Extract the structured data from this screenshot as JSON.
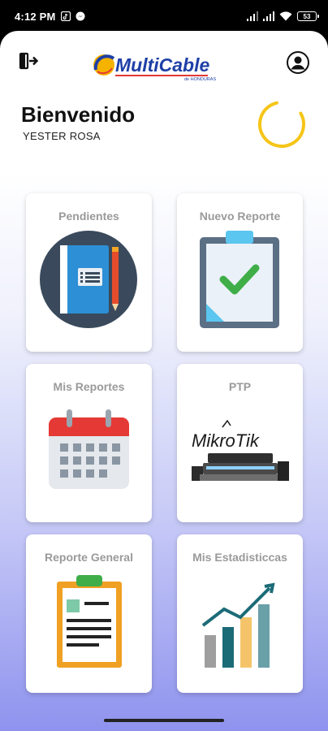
{
  "status_bar": {
    "time": "4:12 PM",
    "battery": "53",
    "icons": [
      "tiktok-icon",
      "messenger-icon",
      "signal-icon",
      "signal-icon",
      "wifi-icon",
      "battery-icon"
    ]
  },
  "header": {
    "logo_text": "MultiCable",
    "logo_subtext": "de HONDURAS",
    "logout_icon": "logout-icon",
    "profile_icon": "profile-icon"
  },
  "welcome": {
    "title": "Bienvenido",
    "user": "YESTER ROSA"
  },
  "cards": [
    {
      "title": "Pendientes",
      "icon": "notebook-icon"
    },
    {
      "title": "Nuevo Reporte",
      "icon": "clipboard-check-icon"
    },
    {
      "title": "Mis Reportes",
      "icon": "calendar-icon"
    },
    {
      "title": "PTP",
      "icon": "mikrotik-router-icon",
      "brand_text": "MikroTik"
    },
    {
      "title": "Reporte General",
      "icon": "clipboard-document-icon"
    },
    {
      "title": "Mis Estadisticcas",
      "icon": "bar-chart-icon"
    }
  ],
  "colors": {
    "spinner": "#f5c518",
    "logo_blue": "#1e3fa6",
    "check_green": "#3fae49",
    "calendar_red": "#e53935",
    "chart_teal": "#1b6b77"
  }
}
